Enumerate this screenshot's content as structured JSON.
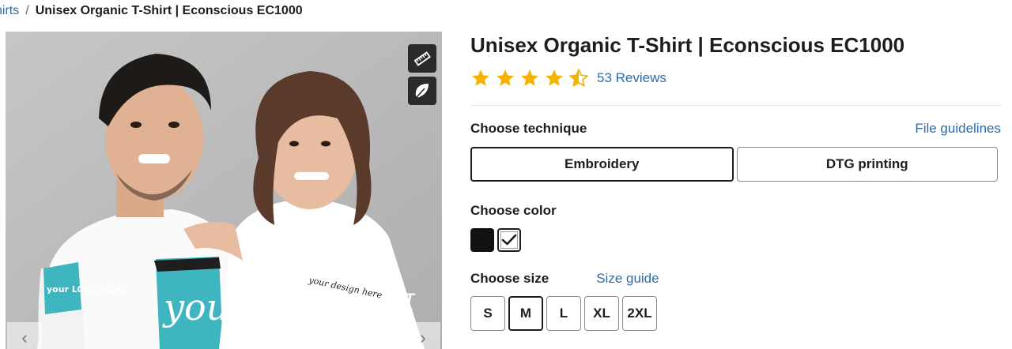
{
  "breadcrumb": {
    "parent": "hirts",
    "separator": "/",
    "current": "Unisex Organic T-Shirt | Econscious EC1000"
  },
  "gallery": {
    "tools": [
      {
        "icon": "ruler-icon"
      },
      {
        "icon": "leaf-icon"
      }
    ],
    "shirt_print_left": "your DESIGN",
    "sleeve_print": "your LOGO HERE",
    "shirt_print_right": "your design here",
    "nav": {
      "prev": "‹",
      "next": "›"
    }
  },
  "product": {
    "title": "Unisex Organic T-Shirt | Econscious EC1000",
    "rating": 4.5,
    "reviews_label": "53 Reviews",
    "star_color": "#f5b301"
  },
  "technique": {
    "label": "Choose technique",
    "link": "File guidelines",
    "options": [
      "Embroidery",
      "DTG printing"
    ],
    "selected": "Embroidery"
  },
  "color": {
    "label": "Choose color",
    "options": [
      {
        "name": "Black",
        "hex": "#111111"
      },
      {
        "name": "White",
        "hex": "#ffffff",
        "selected": true
      }
    ]
  },
  "size": {
    "label": "Choose size",
    "link": "Size guide",
    "options": [
      "S",
      "M",
      "L",
      "XL",
      "2XL"
    ],
    "selected": "M"
  },
  "colors": {
    "link": "#2b6cb0",
    "text": "#1d1d1f",
    "accent_print": "#3fb6bf"
  }
}
